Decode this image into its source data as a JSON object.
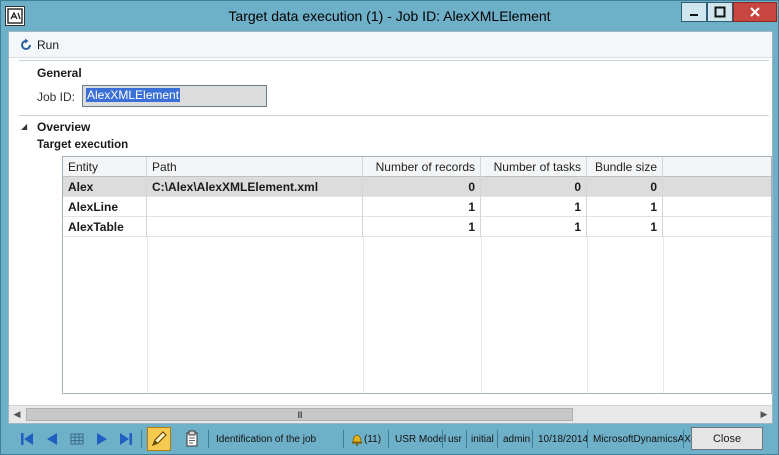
{
  "window": {
    "title": "Target data execution (1) - Job ID: AlexXMLElement"
  },
  "actionpane": {
    "run_label": "Run"
  },
  "general": {
    "header": "General",
    "jobid_label": "Job ID:",
    "jobid_value": "AlexXMLElement"
  },
  "overview": {
    "header": "Overview",
    "subheader": "Target execution"
  },
  "grid": {
    "columns": [
      "Entity",
      "Path",
      "Number of records",
      "Number of tasks",
      "Bundle size"
    ],
    "rows": [
      {
        "entity": "Alex",
        "path": "C:\\Alex\\AlexXMLElement.xml",
        "records": "0",
        "tasks": "0",
        "bundle": "0",
        "selected": true
      },
      {
        "entity": "AlexLine",
        "path": "",
        "records": "1",
        "tasks": "1",
        "bundle": "1",
        "selected": false
      },
      {
        "entity": "AlexTable",
        "path": "",
        "records": "1",
        "tasks": "1",
        "bundle": "1",
        "selected": false
      }
    ]
  },
  "scrollbar": {
    "thumb_grip": "III"
  },
  "statusbar": {
    "description": "Identification of the job",
    "notifications": "(11)",
    "model": "USR Model",
    "layer": "usr",
    "partition": "initial",
    "user": "admin",
    "date": "10/18/2014",
    "company": "MicrosoftDynamicsAX",
    "close_label": "Close"
  },
  "colors": {
    "frame": "#6fb0c9",
    "selection": "#3a6fd8",
    "selected_row": "#dcdcdc",
    "edit_button": "#f7c94e",
    "close_window": "#c7463f",
    "nav_icons": "#1f5fbf"
  },
  "icons": {
    "app": "dynamics-ax-icon",
    "run": "refresh-icon",
    "collapse": "collapse-triangle-icon",
    "nav": [
      "first-record-icon",
      "previous-record-icon",
      "grid-view-icon",
      "next-record-icon",
      "last-record-icon"
    ],
    "edit": "pencil-icon",
    "document": "document-handling-icon",
    "notification": "bell-icon"
  }
}
